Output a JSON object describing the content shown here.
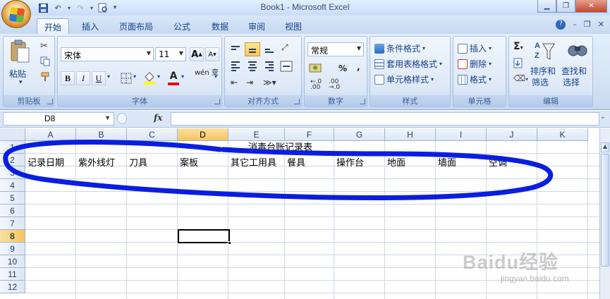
{
  "window": {
    "title": "Book1 - Microsoft Excel",
    "qat_icons": [
      "save-icon",
      "undo-icon",
      "redo-icon",
      "print-preview-icon",
      "customize-icon"
    ],
    "controls": [
      "minimize",
      "restore",
      "close"
    ]
  },
  "tabs": [
    {
      "label": "开始",
      "active": true
    },
    {
      "label": "插入",
      "active": false
    },
    {
      "label": "页面布局",
      "active": false
    },
    {
      "label": "公式",
      "active": false
    },
    {
      "label": "数据",
      "active": false
    },
    {
      "label": "审阅",
      "active": false
    },
    {
      "label": "视图",
      "active": false
    }
  ],
  "ribbon": {
    "clipboard": {
      "label": "剪贴板",
      "paste": "粘贴"
    },
    "font": {
      "label": "字体",
      "font_name": "宋体",
      "font_size": "11",
      "bold": "B",
      "italic": "I",
      "underline": "U",
      "grow": "A",
      "shrink": "A",
      "font_color": "A",
      "phonetic": "wén 变"
    },
    "alignment": {
      "label": "对齐方式"
    },
    "number": {
      "label": "数字",
      "format": "常规",
      "percent": "%",
      "comma": ","
    },
    "styles": {
      "label": "样式",
      "conditional": "条件格式",
      "table_format": "套用表格格式",
      "cell_styles": "单元格样式"
    },
    "cells": {
      "label": "单元格",
      "insert": "插入",
      "delete": "删除",
      "format": "格式"
    },
    "editing": {
      "label": "编辑",
      "sort_filter": "排序和\n筛选",
      "sort": "排序和",
      "filter": "筛选",
      "find": "查找和",
      "select": "选择"
    }
  },
  "formula_bar": {
    "name_box": "D8",
    "fx": "fx",
    "content": ""
  },
  "grid": {
    "columns": [
      "A",
      "B",
      "C",
      "D",
      "E",
      "F",
      "G",
      "H",
      "I",
      "J",
      "K"
    ],
    "rows": [
      "1",
      "2",
      "3",
      "4",
      "5",
      "6",
      "7",
      "8",
      "9",
      "10",
      "11",
      "12"
    ],
    "selected_column": "D",
    "selected_row": "8",
    "row1_title": "消毒台账记录表",
    "row2_headers": [
      "记录日期",
      "紫外线灯",
      "刀具",
      "案板",
      "其它工用具",
      "餐具",
      "操作台",
      "地面",
      "墙面",
      "空调"
    ]
  },
  "annotation_color": "#0a1ee0",
  "watermark": {
    "main": "Baidu经验",
    "sub": "jingyan.baidu.com"
  }
}
